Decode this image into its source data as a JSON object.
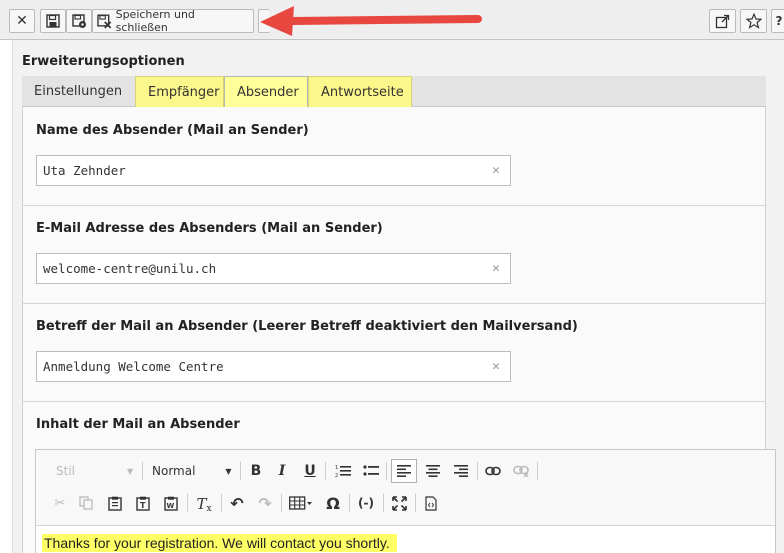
{
  "toolbar": {
    "save_close_label": "Speichern und schließen"
  },
  "section_title": "Erweiterungsoptionen",
  "tabs": [
    {
      "label": "Einstellungen"
    },
    {
      "label": "Empfänger"
    },
    {
      "label": "Absender"
    },
    {
      "label": "Antwortseite"
    }
  ],
  "fields": [
    {
      "label": "Name des Absender (Mail an Sender)",
      "value": "Uta Zehnder"
    },
    {
      "label": "E-Mail Adresse des Absenders (Mail an Sender)",
      "value": "welcome-centre@unilu.ch"
    },
    {
      "label": "Betreff der Mail an Absender (Leerer Betreff deaktiviert den Mailversand)",
      "value": "Anmeldung Welcome Centre"
    }
  ],
  "content_label": "Inhalt der Mail an Absender",
  "editor": {
    "style_combo": "Stil",
    "format_combo": "Normal",
    "body_text": "Thanks for your registration. We will contact you shortly."
  },
  "colors": {
    "highlight": "#ffff66",
    "arrow": "#e8473f"
  }
}
